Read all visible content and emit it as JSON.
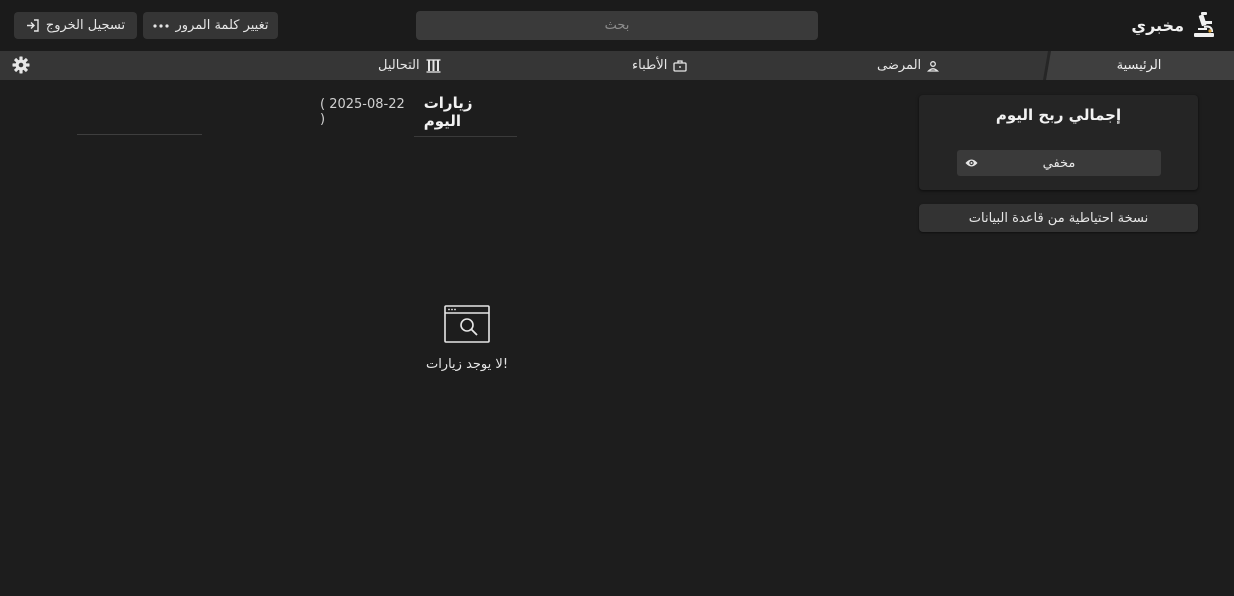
{
  "app": {
    "title": "مخبري",
    "logo_icon": "microscope-icon"
  },
  "header": {
    "search_placeholder": "بحث",
    "logout_label": "تسجيل الخروج",
    "change_password_label": "تغيير كلمة المرور"
  },
  "nav": {
    "home": "الرئيسية",
    "patients": "المرضى",
    "doctors": "الأطباء",
    "tests": "التحاليل"
  },
  "profit_card": {
    "title": "إجمالي ربح اليوم",
    "hidden_label": "مخفي"
  },
  "backup_label": "نسخة احتياطية من قاعدة البيانات",
  "visits": {
    "title": "زيارات اليوم",
    "date": "( 2025-08-22 )",
    "empty_text": "لا يوجد زيارات!"
  },
  "colors": {
    "background": "#1d1d1d",
    "panel": "#252525",
    "button": "#353535",
    "text": "#e6e6e6"
  }
}
